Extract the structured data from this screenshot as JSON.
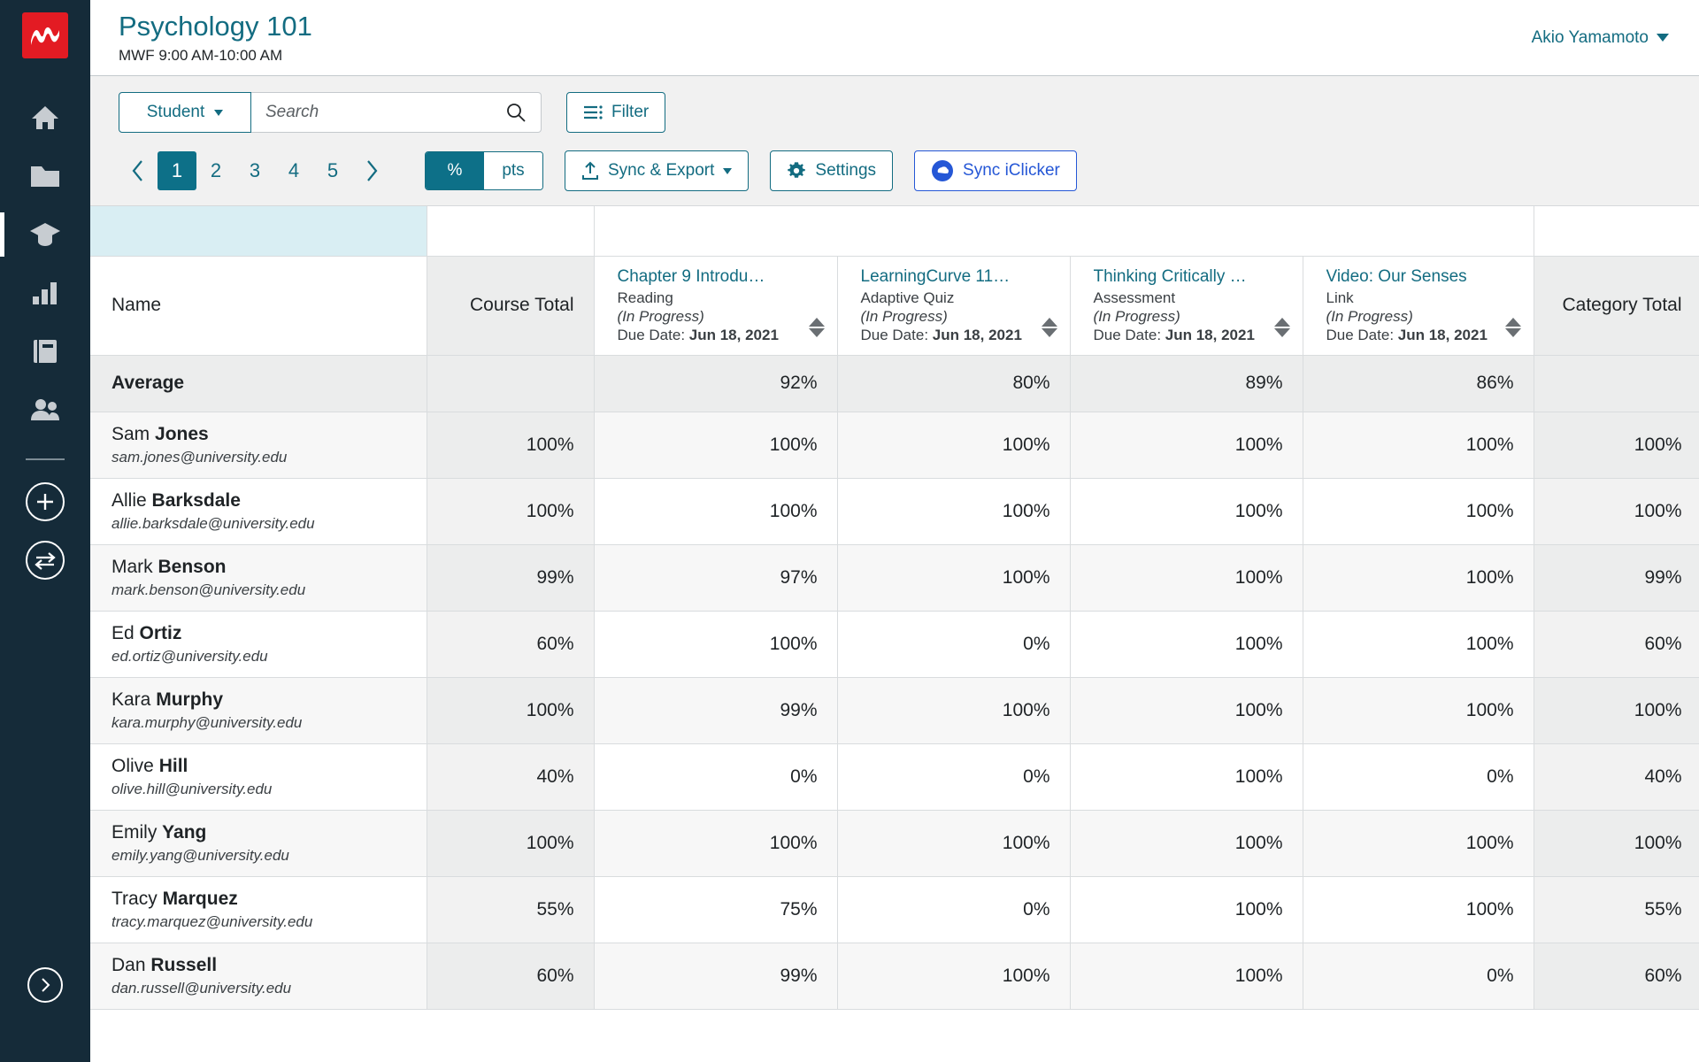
{
  "sidebar": {
    "logo_name": "macmillan-logo",
    "items": [
      {
        "name": "home-icon",
        "label": "Home",
        "active": false
      },
      {
        "name": "folder-icon",
        "label": "Resources",
        "active": false
      },
      {
        "name": "graduation-cap-icon",
        "label": "Gradebook",
        "active": true
      },
      {
        "name": "bar-chart-icon",
        "label": "Reports",
        "active": false
      },
      {
        "name": "book-icon",
        "label": "E-Book",
        "active": false
      },
      {
        "name": "people-icon",
        "label": "Roster",
        "active": false
      }
    ],
    "actions": [
      {
        "name": "add-circle-icon",
        "label": "Add"
      },
      {
        "name": "swap-circle-icon",
        "label": "Switch Course"
      }
    ],
    "expand_label": "Expand"
  },
  "header": {
    "course_title": "Psychology 101",
    "course_schedule": "MWF 9:00 AM-10:00 AM",
    "user_name": "Akio Yamamoto"
  },
  "toolbar": {
    "scope_select": "Student",
    "search_placeholder": "Search",
    "search_value": "",
    "filter_label": "Filter",
    "pagination": {
      "prev": "‹",
      "next": "›",
      "pages": [
        "1",
        "2",
        "3",
        "4",
        "5"
      ],
      "active_page": "1"
    },
    "units": {
      "percent": "%",
      "points": "pts",
      "selected": "%"
    },
    "sync_export_label": "Sync & Export",
    "settings_label": "Settings",
    "sync_iclicker_label": "Sync iClicker"
  },
  "table": {
    "name_header": "Name",
    "course_total_header": "Course Total",
    "category_total_header": "Category Total",
    "assignments": [
      {
        "title": "Chapter 9 Introdu…",
        "type": "Reading",
        "status": "(In Progress)",
        "due_label": "Due Date:",
        "due_date": "Jun 18, 2021"
      },
      {
        "title": "LearningCurve 11…",
        "type": "Adaptive Quiz",
        "status": "(In Progress)",
        "due_label": "Due Date:",
        "due_date": "Jun 18, 2021"
      },
      {
        "title": "Thinking Critically …",
        "type": "Assessment",
        "status": "(In Progress)",
        "due_label": "Due Date:",
        "due_date": "Jun 18, 2021"
      },
      {
        "title": "Video: Our Senses",
        "type": "Link",
        "status": "(In Progress)",
        "due_label": "Due Date:",
        "due_date": "Jun 18, 2021"
      }
    ],
    "average_row": {
      "label": "Average",
      "course_total": "",
      "scores": [
        "92%",
        "80%",
        "89%",
        "86%"
      ],
      "category_total": ""
    },
    "students": [
      {
        "first": "Sam",
        "last": "Jones",
        "email": "sam.jones@university.edu",
        "course_total": "100%",
        "scores": [
          "100%",
          "100%",
          "100%",
          "100%"
        ],
        "category_total": "100%"
      },
      {
        "first": "Allie",
        "last": "Barksdale",
        "email": "allie.barksdale@university.edu",
        "course_total": "100%",
        "scores": [
          "100%",
          "100%",
          "100%",
          "100%"
        ],
        "category_total": "100%"
      },
      {
        "first": "Mark",
        "last": "Benson",
        "email": "mark.benson@university.edu",
        "course_total": "99%",
        "scores": [
          "97%",
          "100%",
          "100%",
          "100%"
        ],
        "category_total": "99%"
      },
      {
        "first": "Ed",
        "last": "Ortiz",
        "email": "ed.ortiz@university.edu",
        "course_total": "60%",
        "scores": [
          "100%",
          "0%",
          "100%",
          "100%"
        ],
        "category_total": "60%"
      },
      {
        "first": "Kara",
        "last": "Murphy",
        "email": "kara.murphy@university.edu",
        "course_total": "100%",
        "scores": [
          "99%",
          "100%",
          "100%",
          "100%"
        ],
        "category_total": "100%"
      },
      {
        "first": "Olive",
        "last": "Hill",
        "email": "olive.hill@university.edu",
        "course_total": "40%",
        "scores": [
          "0%",
          "0%",
          "100%",
          "0%"
        ],
        "category_total": "40%"
      },
      {
        "first": "Emily",
        "last": "Yang",
        "email": "emily.yang@university.edu",
        "course_total": "100%",
        "scores": [
          "100%",
          "100%",
          "100%",
          "100%"
        ],
        "category_total": "100%"
      },
      {
        "first": "Tracy",
        "last": "Marquez",
        "email": "tracy.marquez@university.edu",
        "course_total": "55%",
        "scores": [
          "75%",
          "0%",
          "100%",
          "100%"
        ],
        "category_total": "55%"
      },
      {
        "first": "Dan",
        "last": "Russell",
        "email": "dan.russell@university.edu",
        "course_total": "60%",
        "scores": [
          "99%",
          "100%",
          "100%",
          "0%"
        ],
        "category_total": "60%"
      }
    ]
  },
  "colors": {
    "sidebar_bg": "#152b39",
    "logo_red": "#e31b23",
    "teal": "#136c81",
    "teal_solid": "#0d7088",
    "iclicker_blue": "#2557d6",
    "tint_blue": "#d9eef3"
  }
}
